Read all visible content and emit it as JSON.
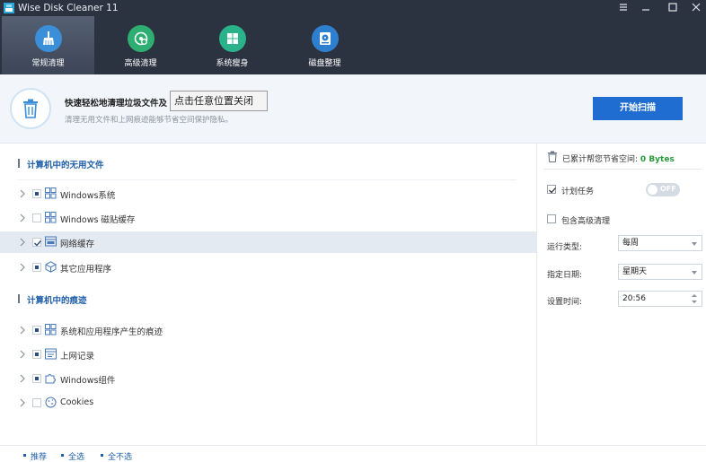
{
  "app": {
    "title": "Wise Disk Cleaner 11"
  },
  "nav": {
    "items": [
      {
        "label": "常规清理",
        "icon": "broom-icon",
        "color": "#3a8fd8",
        "active": true
      },
      {
        "label": "高级清理",
        "icon": "disk-search-icon",
        "color": "#2fae72",
        "active": false
      },
      {
        "label": "系统瘦身",
        "icon": "windows-icon",
        "color": "#2ab38a",
        "active": false
      },
      {
        "label": "磁盘整理",
        "icon": "disk-defrag-icon",
        "color": "#2e7fd0",
        "active": false
      }
    ]
  },
  "header": {
    "title": "快速轻松地清理垃圾文件及",
    "subtitle": "清理无用文件和上网痕迹能够节省空间保护隐私。",
    "tooltip": "点击任意位置关闭",
    "scan_button": "开始扫描"
  },
  "sections": [
    {
      "title": "计算机中的无用文件",
      "items": [
        {
          "label": "Windows系统",
          "state": "partial",
          "icon": "windows-grid-icon"
        },
        {
          "label": "Windows 磁贴缓存",
          "state": "unchecked",
          "icon": "tiles-icon"
        },
        {
          "label": "网络缓存",
          "state": "checked",
          "icon": "web-cache-icon"
        },
        {
          "label": "其它应用程序",
          "state": "partial",
          "icon": "package-icon"
        }
      ]
    },
    {
      "title": "计算机中的痕迹",
      "items": [
        {
          "label": "系统和应用程序产生的痕迹",
          "state": "partial",
          "icon": "windows-grid-icon"
        },
        {
          "label": "上网记录",
          "state": "partial",
          "icon": "browser-history-icon"
        },
        {
          "label": "Windows组件",
          "state": "partial",
          "icon": "puzzle-icon"
        },
        {
          "label": "Cookies",
          "state": "unchecked",
          "icon": "cookie-icon"
        }
      ]
    }
  ],
  "right_panel": {
    "saved_label": "已累计帮您节省空间:",
    "saved_value": "0 Bytes",
    "schedule_label": "计划任务",
    "schedule_checked": true,
    "toggle_text": "OFF",
    "advanced_label": "包含高级清理",
    "advanced_checked": false,
    "run_type_label": "运行类型:",
    "run_type_value": "每周",
    "date_label": "指定日期:",
    "date_value": "星期天",
    "time_label": "设置时间:",
    "time_value": "20:56"
  },
  "footer": {
    "recommend": "推荐",
    "select_all": "全选",
    "select_none": "全不选"
  }
}
